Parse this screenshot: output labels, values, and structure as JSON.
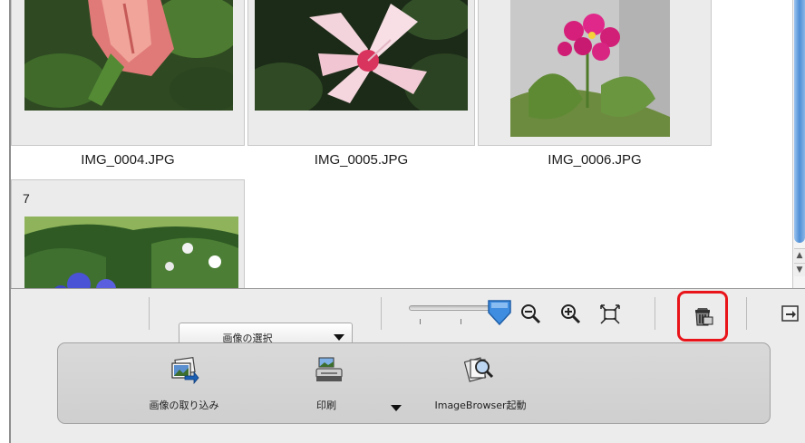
{
  "thumbnails": [
    {
      "filename": "IMG_0004.JPG"
    },
    {
      "filename": "IMG_0005.JPG"
    },
    {
      "filename": "IMG_0006.JPG"
    },
    {
      "number": "7"
    }
  ],
  "toolbar": {
    "select_label": "画像の選択",
    "zoom_level": 0.95,
    "icons": [
      "zoom-out-icon",
      "zoom-in-icon",
      "fit-to-window-icon",
      "trash-icon",
      "export-icon"
    ],
    "highlight_color": "#e8141a"
  },
  "actions": {
    "import_label": "画像の取り込み",
    "print_label": "印刷",
    "browser_label": "ImageBrowser起動"
  }
}
